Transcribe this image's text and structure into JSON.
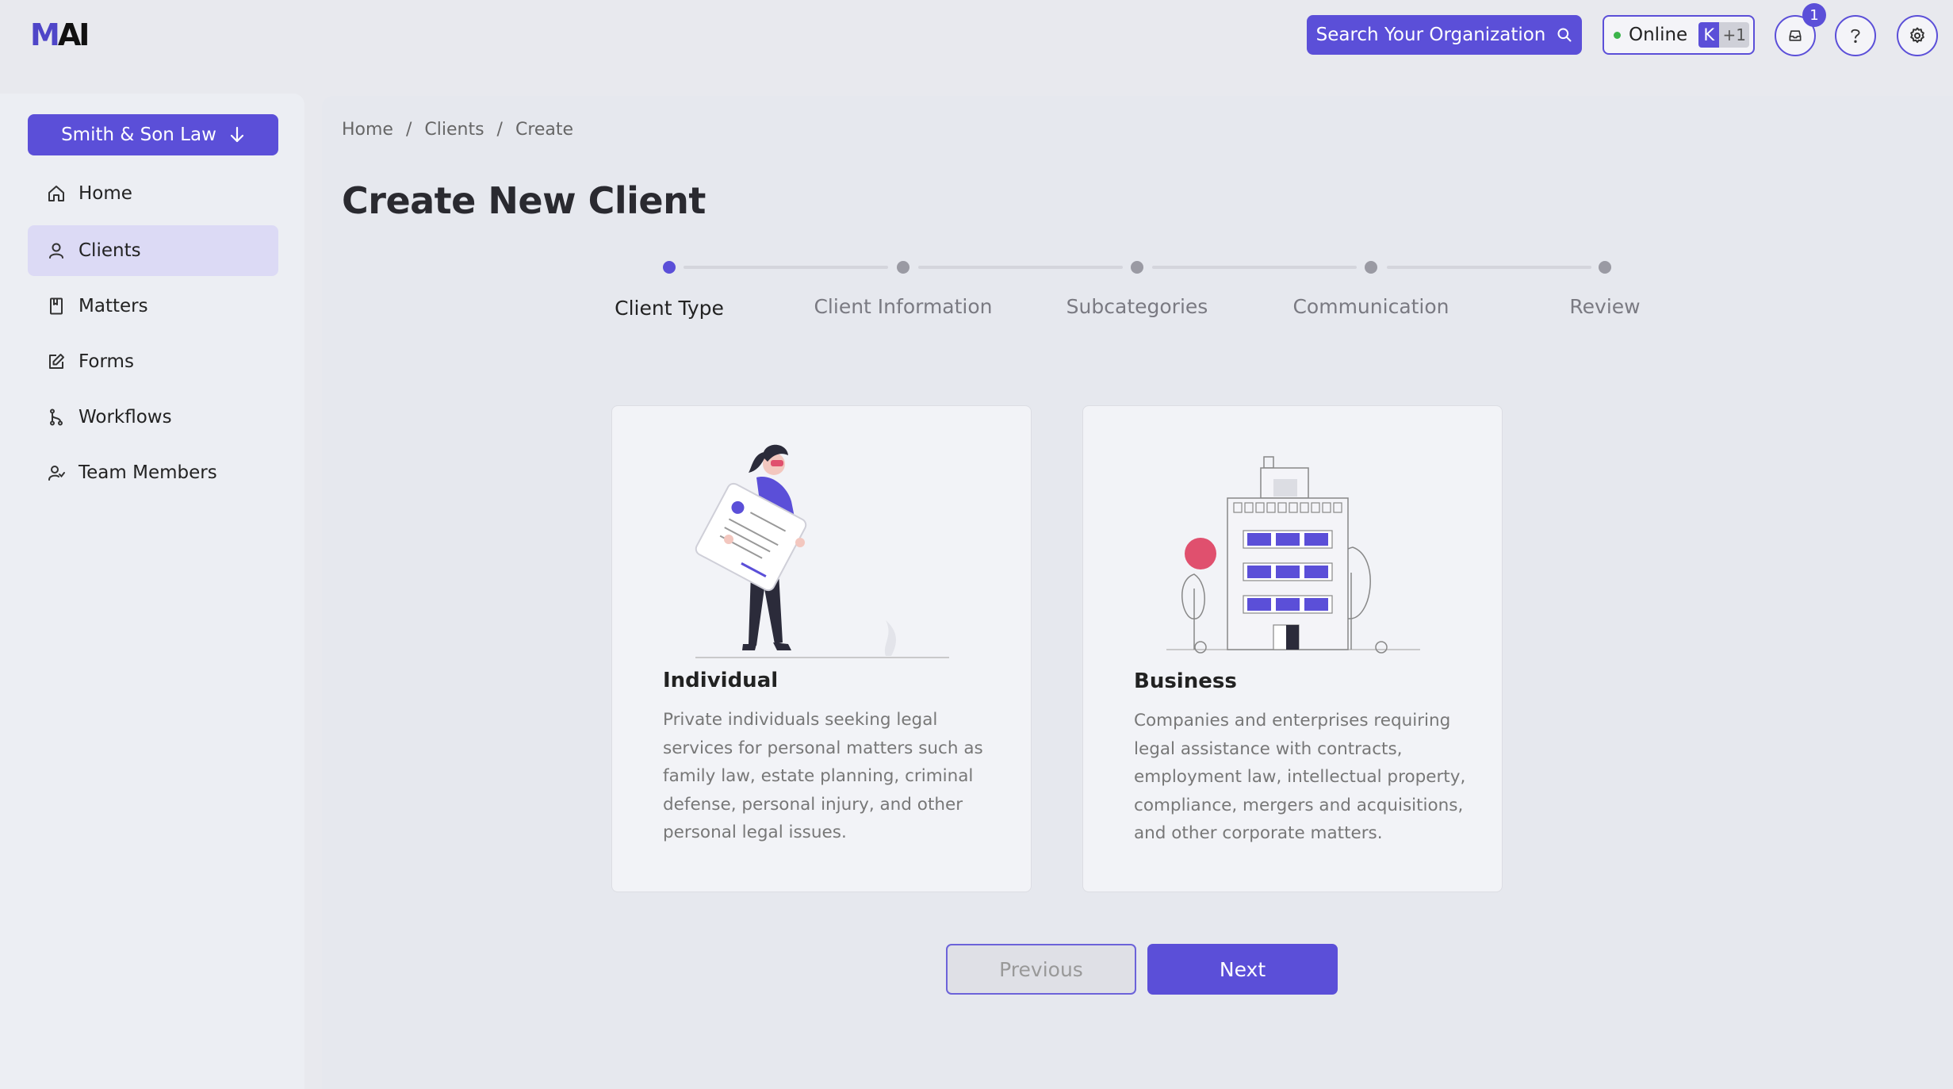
{
  "header": {
    "logo_m": "M",
    "logo_ai": "AI",
    "search_label": "Search Your Organization",
    "status_label": "Online",
    "avatar_initial": "K",
    "avatar_more": "+1",
    "notification_count": "1"
  },
  "sidebar": {
    "org_label": "Smith & Son Law",
    "items": [
      {
        "label": "Home",
        "icon": "home-icon",
        "active": false
      },
      {
        "label": "Clients",
        "icon": "user-icon",
        "active": true
      },
      {
        "label": "Matters",
        "icon": "book-icon",
        "active": false
      },
      {
        "label": "Forms",
        "icon": "edit-icon",
        "active": false
      },
      {
        "label": "Workflows",
        "icon": "workflow-icon",
        "active": false
      },
      {
        "label": "Team Members",
        "icon": "team-icon",
        "active": false
      }
    ]
  },
  "main": {
    "breadcrumb": [
      "Home",
      "/",
      "Clients",
      "/",
      "Create"
    ],
    "title": "Create New Client",
    "steps": [
      "Client Type",
      "Client Information",
      "Subcategories",
      "Communication",
      "Review"
    ],
    "active_step": 0,
    "cards": [
      {
        "title": "Individual",
        "description": "Private individuals seeking legal services for personal matters such as family law, estate planning, criminal defense, personal injury, and other personal legal issues."
      },
      {
        "title": "Business",
        "description": "Companies and enterprises requiring legal assistance with contracts, employment law, intellectual property, compliance, mergers and acquisitions, and other corporate matters."
      }
    ],
    "previous_label": "Previous",
    "next_label": "Next"
  },
  "colors": {
    "accent": "#5b4fd8",
    "background": "#e8e9ee",
    "active_nav": "#dcdaf5",
    "online_dot": "#3cb44b"
  }
}
